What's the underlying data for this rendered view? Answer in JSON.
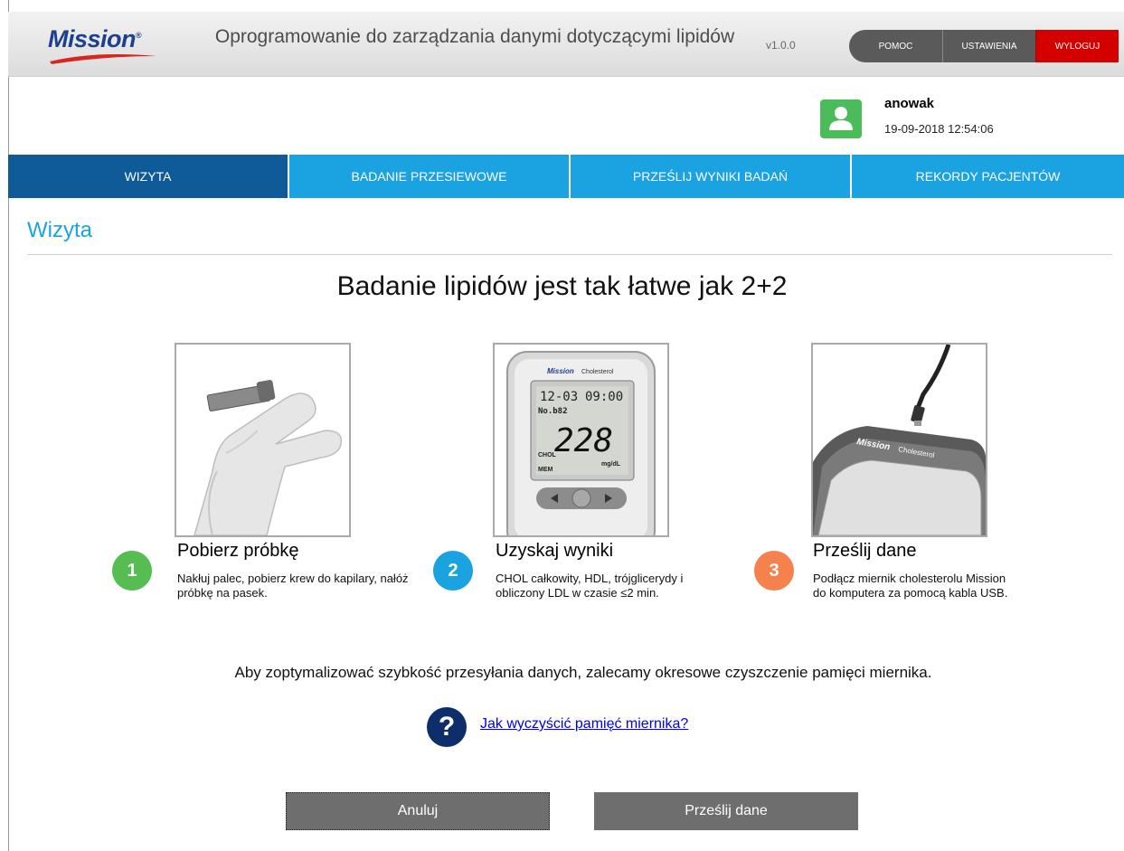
{
  "header": {
    "logo_text": "Mission",
    "logo_reg": "®",
    "title": "Oprogramowanie do zarządzania danymi dotyczącymi lipidów",
    "version": "v1.0.0",
    "buttons": {
      "help": "POMOC",
      "settings": "USTAWIENIA",
      "logout": "WYLOGUJ"
    }
  },
  "user": {
    "name": "anowak",
    "datetime": "19-09-2018 12:54:06",
    "avatar_icon": "user-icon"
  },
  "nav": {
    "tabs": [
      {
        "label": "WIZYTA",
        "active": true
      },
      {
        "label": "BADANIE PRZESIEWOWE",
        "active": false
      },
      {
        "label": "PRZEŚLIJ WYNIKI BADAŃ",
        "active": false
      },
      {
        "label": "REKORDY PACJENTÓW",
        "active": false
      }
    ]
  },
  "page": {
    "title": "Wizyta",
    "headline": "Badanie lipidów jest tak łatwe jak 2+2"
  },
  "steps": [
    {
      "number": "1",
      "title": "Pobierz próbkę",
      "desc": "Nakłuj palec, pobierz krew do kapilary, nałóż próbkę na pasek.",
      "color": "#55bd52"
    },
    {
      "number": "2",
      "title": "Uzyskaj wyniki",
      "desc": "CHOL całkowity, HDL, trójglicerydy i obliczony LDL w czasie ≤2 min.",
      "color": "#1ba3e1"
    },
    {
      "number": "3",
      "title": "Prześlij dane",
      "desc": "Podłącz miernik cholesterolu Mission do komputera za pomocą kabla USB.",
      "color": "#f5814f"
    }
  ],
  "meter_display": {
    "date": "12-03",
    "time": "09:00",
    "record": "No.b82",
    "value": "228",
    "label_chol": "CHOL",
    "label_mem": "MEM",
    "unit": "mg/dL",
    "brand": "Mission",
    "model": "Cholesterol"
  },
  "notice": "Aby zoptymalizować szybkość przesyłania danych, zalecamy okresowe czyszczenie pamięci miernika.",
  "help": {
    "icon_glyph": "?",
    "link": "Jak wyczyścić pamięć miernika?"
  },
  "actions": {
    "cancel": "Anuluj",
    "send": "Prześlij dane"
  },
  "colors": {
    "nav_active": "#0f5a99",
    "nav": "#1ba3e1",
    "logout": "#d40000",
    "avatar": "#4cbc5a"
  }
}
